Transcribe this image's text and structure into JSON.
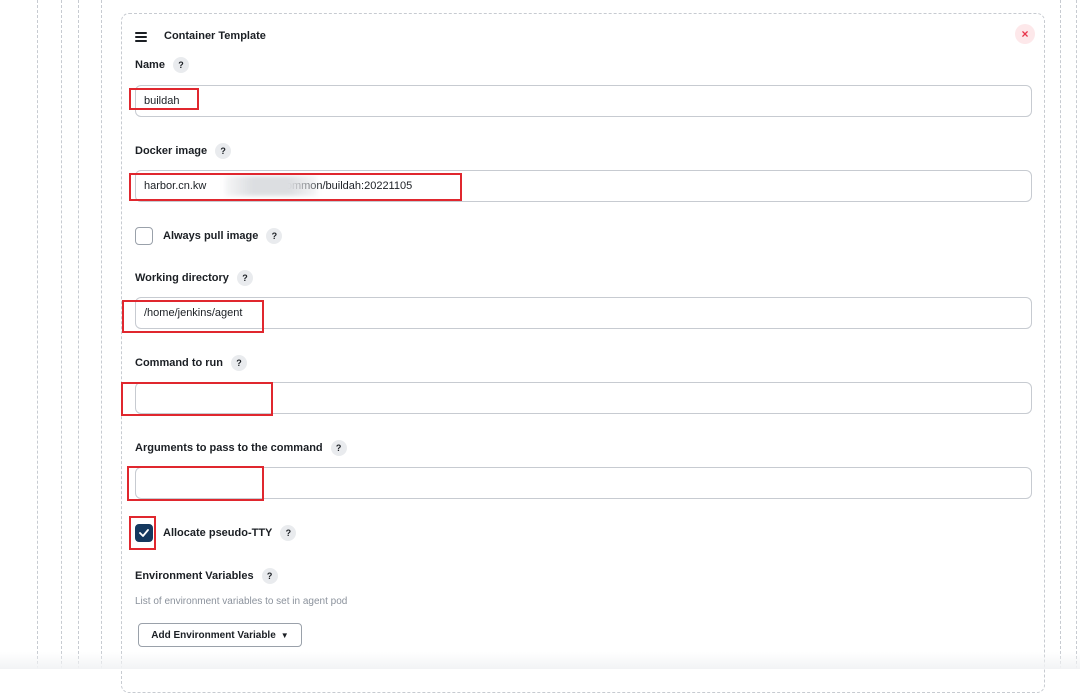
{
  "card": {
    "title": "Container Template",
    "close_label": "×"
  },
  "help_glyph": "?",
  "fields": {
    "name": {
      "label": "Name",
      "value": "buildah"
    },
    "docker_image": {
      "label": "Docker image",
      "value": "harbor.cn.kw                          ommon/buildah:20221105"
    },
    "always_pull": {
      "label": "Always pull image",
      "checked": false
    },
    "working_directory": {
      "label": "Working directory",
      "value": "/home/jenkins/agent"
    },
    "command_to_run": {
      "label": "Command to run",
      "value": ""
    },
    "arguments": {
      "label": "Arguments to pass to the command",
      "value": ""
    },
    "allocate_tty": {
      "label": "Allocate pseudo-TTY",
      "checked": true
    }
  },
  "env": {
    "label": "Environment Variables",
    "description": "List of environment variables to set in agent pod",
    "add_button_label": "Add Environment Variable"
  },
  "colors": {
    "highlight": "#e0272e",
    "checkbox_checked": "#14385e",
    "close_icon": "#e8354b"
  }
}
